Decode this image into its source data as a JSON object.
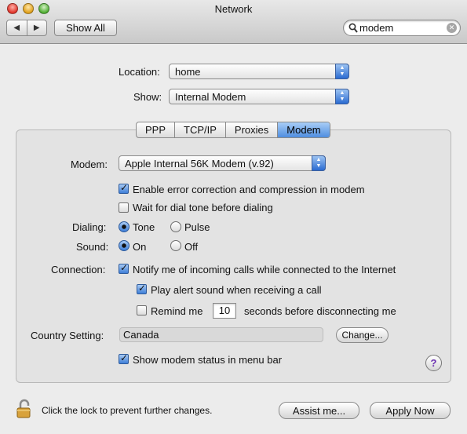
{
  "window": {
    "title": "Network"
  },
  "toolbar": {
    "back_glyph": "◀",
    "forward_glyph": "▶",
    "show_all_label": "Show All",
    "search_value": "modem"
  },
  "location": {
    "label": "Location:",
    "value": "home"
  },
  "show": {
    "label": "Show:",
    "value": "Internal Modem"
  },
  "tabs": [
    {
      "label": "PPP",
      "active": false
    },
    {
      "label": "TCP/IP",
      "active": false
    },
    {
      "label": "Proxies",
      "active": false
    },
    {
      "label": "Modem",
      "active": true
    }
  ],
  "modem": {
    "label": "Modem:",
    "value": "Apple Internal 56K Modem (v.92)"
  },
  "options": {
    "error_correction": {
      "label": "Enable error correction and compression in modem",
      "checked": true
    },
    "wait_dial_tone": {
      "label": "Wait for dial tone before dialing",
      "checked": false
    }
  },
  "dialing": {
    "label": "Dialing:",
    "tone": "Tone",
    "pulse": "Pulse",
    "selected": "Tone"
  },
  "sound": {
    "label": "Sound:",
    "on": "On",
    "off": "Off",
    "selected": "On"
  },
  "connection": {
    "label": "Connection:",
    "notify": {
      "label": "Notify me of incoming calls while connected to the Internet",
      "checked": true
    },
    "play_alert": {
      "label": "Play alert sound when receiving a call",
      "checked": true
    },
    "remind": {
      "label_before": "Remind me",
      "value": "10",
      "label_after": "seconds before disconnecting me",
      "checked": false
    }
  },
  "country": {
    "label": "Country Setting:",
    "value": "Canada",
    "change_button": "Change..."
  },
  "show_status": {
    "label": "Show modem status in menu bar",
    "checked": true
  },
  "help_glyph": "?",
  "footer": {
    "lock_text": "Click the lock to prevent further changes.",
    "assist_button": "Assist me...",
    "apply_button": "Apply Now"
  }
}
